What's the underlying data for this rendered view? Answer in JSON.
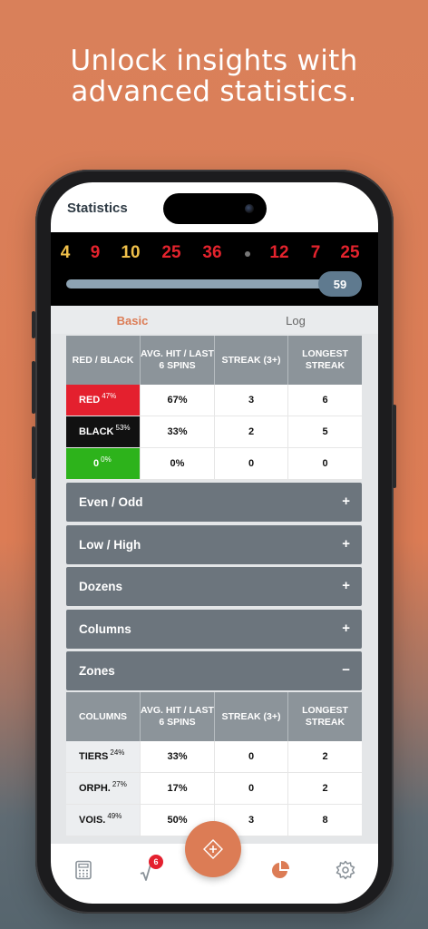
{
  "headline": {
    "line1": "Unlock insights with",
    "line2": "advanced statistics."
  },
  "appbar": {
    "title": "Statistics"
  },
  "recent_numbers": [
    "4",
    "9",
    "10",
    "25",
    "36",
    "12",
    "7",
    "25"
  ],
  "slider": {
    "value": "59"
  },
  "tabs": {
    "basic": "Basic",
    "log": "Log"
  },
  "red_black_table": {
    "headers": [
      "RED / BLACK",
      "AVG. HIT / LAST 6 SPINS",
      "STREAK (3+)",
      "LONGEST STREAK"
    ],
    "rows": [
      {
        "label": "RED",
        "pct": "47%",
        "avg": "67%",
        "streak": "3",
        "longest": "6"
      },
      {
        "label": "BLACK",
        "pct": "53%",
        "avg": "33%",
        "streak": "2",
        "longest": "5"
      },
      {
        "label": "0",
        "pct": "0%",
        "avg": "0%",
        "streak": "0",
        "longest": "0"
      }
    ]
  },
  "sections": [
    {
      "title": "Even / Odd",
      "icon": "+"
    },
    {
      "title": "Low / High",
      "icon": "+"
    },
    {
      "title": "Dozens",
      "icon": "+"
    },
    {
      "title": "Columns",
      "icon": "+"
    },
    {
      "title": "Zones",
      "icon": "−"
    }
  ],
  "zones_table": {
    "headers": [
      "COLUMNS",
      "AVG. HIT / LAST 6 SPINS",
      "STREAK (3+)",
      "LONGEST STREAK"
    ],
    "rows": [
      {
        "label": "TIERS",
        "pct": "24%",
        "avg": "33%",
        "streak": "0",
        "longest": "2"
      },
      {
        "label": "ORPH.",
        "pct": "27%",
        "avg": "17%",
        "streak": "0",
        "longest": "2"
      },
      {
        "label": "VOIS.",
        "pct": "49%",
        "avg": "50%",
        "streak": "3",
        "longest": "8"
      }
    ]
  },
  "bottom_nav": {
    "badge": "6",
    "icons": [
      "calculator-icon",
      "sqrt-icon",
      "diamond-plus-icon",
      "pie-chart-icon",
      "gear-icon"
    ],
    "active_color": "#dc7c55"
  },
  "colors": {
    "accent": "#dc7c55",
    "red": "#e4202e",
    "gold": "#f0c04a",
    "green": "#2db31b"
  }
}
